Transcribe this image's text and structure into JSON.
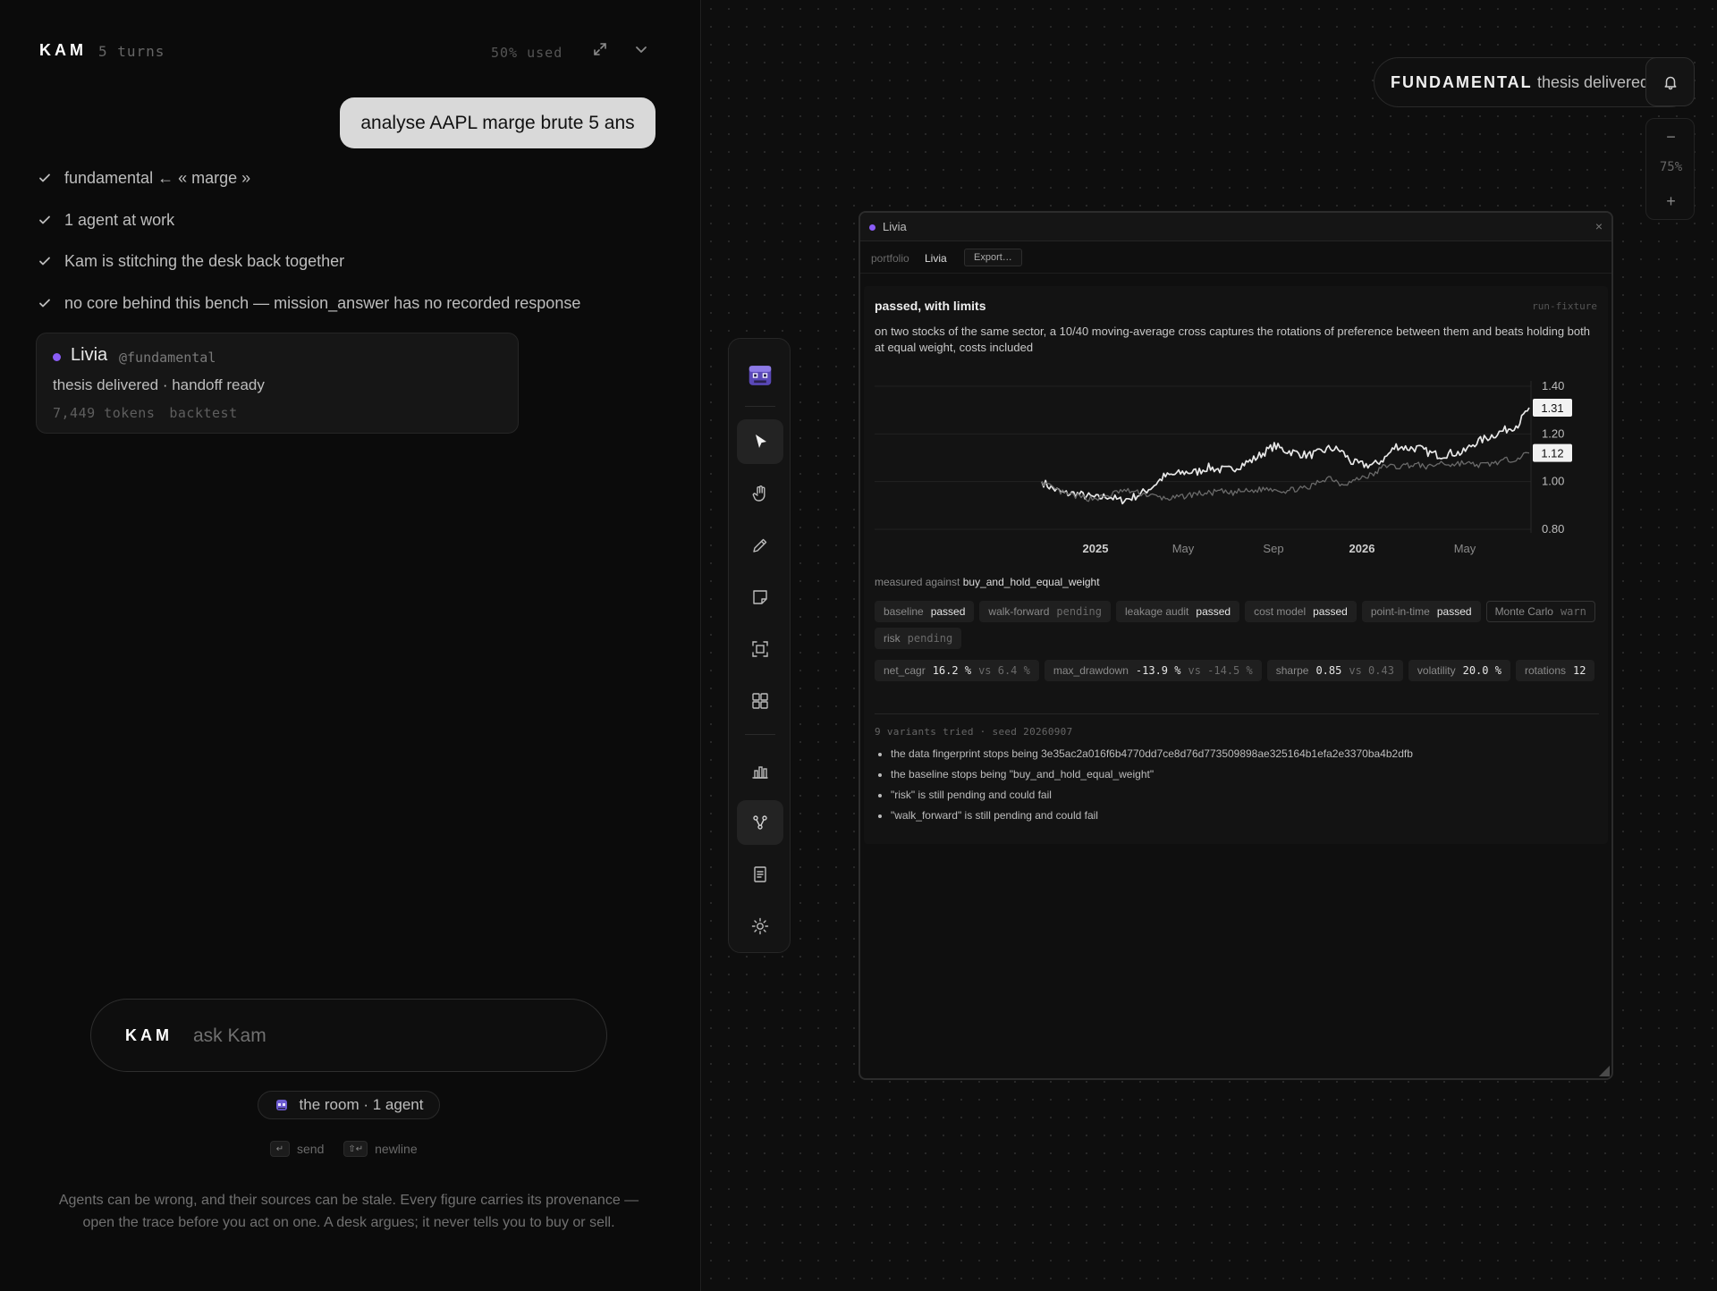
{
  "left": {
    "brand": "KAM",
    "turns": "5 turns",
    "usage": "50% used",
    "user_message": "analyse AAPL marge brute 5 ans",
    "status": [
      "fundamental ← « marge »",
      "1 agent at work",
      "Kam is stitching the desk back together",
      "no core behind this bench — mission_answer has no recorded response"
    ],
    "agent": {
      "name": "Livia",
      "handle": "@fundamental",
      "status": "thesis delivered · handoff ready",
      "tokens": "7,449 tokens",
      "tag": "backtest"
    },
    "input": {
      "brand": "KAM",
      "placeholder": "ask Kam"
    },
    "room": "the room · 1 agent",
    "shortcuts": [
      {
        "key": "↵",
        "label": "send"
      },
      {
        "key": "⇧↵",
        "label": "newline"
      }
    ],
    "disclaimer": "Agents can be wrong, and their sources can be stale. Every figure carries its provenance — open the trace before you act on one. A desk argues; it never tells you to buy or sell."
  },
  "top_pill": {
    "label": "FUNDAMENTAL",
    "status": "thesis delivered"
  },
  "zoom": {
    "minus": "−",
    "level": "75%",
    "plus": "+"
  },
  "toolbar": {
    "tools": [
      "avatar",
      "select",
      "hand",
      "pencil",
      "note",
      "frame",
      "grid",
      "chart",
      "nodes",
      "document",
      "settings"
    ],
    "active": [
      "select",
      "nodes"
    ]
  },
  "window": {
    "title": "Livia",
    "close": "×",
    "sub_label": "portfolio",
    "portfolio": "Livia",
    "export": "Export…",
    "verdict": "passed, with limits",
    "run_tag": "run-fixture",
    "thesis": "on two stocks of the same sector, a 10/40 moving-average cross captures the rotations of preference between them and beats holding both at equal weight, costs included",
    "benchmark_prefix": "measured against",
    "benchmark": "buy_and_hold_equal_weight",
    "checks": [
      {
        "name": "baseline",
        "state": "passed"
      },
      {
        "name": "walk-forward",
        "state": "pending"
      },
      {
        "name": "leakage audit",
        "state": "passed"
      },
      {
        "name": "cost model",
        "state": "passed"
      },
      {
        "name": "point-in-time",
        "state": "passed"
      },
      {
        "name": "Monte Carlo",
        "state": "warn"
      },
      {
        "name": "risk",
        "state": "pending"
      }
    ],
    "metrics": [
      {
        "name": "net_cagr",
        "value": "16.2 %",
        "vs": "vs 6.4 %"
      },
      {
        "name": "max_drawdown",
        "value": "-13.9 %",
        "vs": "vs -14.5 %"
      },
      {
        "name": "sharpe",
        "value": "0.85",
        "vs": "vs 0.43"
      },
      {
        "name": "volatility",
        "value": "20.0 %",
        "vs": ""
      },
      {
        "name": "rotations",
        "value": "12",
        "vs": ""
      }
    ],
    "variants": "9 variants tried · seed 20260907",
    "notes": [
      "the data fingerprint stops being 3e35ac2a016f6b4770dd7ce8d76d773509898ae325164b1efa2e3370ba4b2dfb",
      "the baseline stops being \"buy_and_hold_equal_weight\"",
      "\"risk\" is still pending and could fail",
      "\"walk_forward\" is still pending and could fail"
    ]
  },
  "chart_data": {
    "type": "line",
    "x_ticks": [
      "2025",
      "May",
      "Sep",
      "2026",
      "May"
    ],
    "bold_ticks": [
      "2025",
      "2026"
    ],
    "y_ticks": [
      1.4,
      1.2,
      1.0,
      0.8
    ],
    "ylim": [
      0.8,
      1.4
    ],
    "grid": true,
    "series": [
      {
        "role": "strategy",
        "color": "#e8e8e8",
        "end_label": "1.31",
        "values": [
          1.0,
          0.97,
          0.95,
          0.95,
          0.94,
          0.93,
          0.94,
          0.92,
          0.93,
          0.95,
          0.98,
          1.02,
          1.03,
          1.04,
          1.04,
          1.06,
          1.05,
          1.05,
          1.07,
          1.09,
          1.12,
          1.15,
          1.13,
          1.12,
          1.11,
          1.12,
          1.14,
          1.13,
          1.08,
          1.07,
          1.07,
          1.1,
          1.15,
          1.14,
          1.14,
          1.12,
          1.11,
          1.12,
          1.12,
          1.16,
          1.18,
          1.2,
          1.22,
          1.24,
          1.31
        ]
      },
      {
        "role": "benchmark",
        "color": "#6a6a6a",
        "end_label": "1.12",
        "values": [
          1.0,
          0.97,
          0.95,
          0.94,
          0.93,
          0.93,
          0.94,
          0.96,
          0.96,
          0.95,
          0.94,
          0.93,
          0.93,
          0.94,
          0.95,
          0.95,
          0.96,
          0.95,
          0.96,
          0.96,
          0.97,
          0.97,
          0.96,
          0.97,
          0.97,
          1.0,
          1.02,
          0.99,
          1.0,
          1.02,
          1.03,
          1.07,
          1.06,
          1.07,
          1.07,
          1.06,
          1.08,
          1.07,
          1.08,
          1.07,
          1.07,
          1.08,
          1.09,
          1.1,
          1.12
        ]
      }
    ]
  }
}
